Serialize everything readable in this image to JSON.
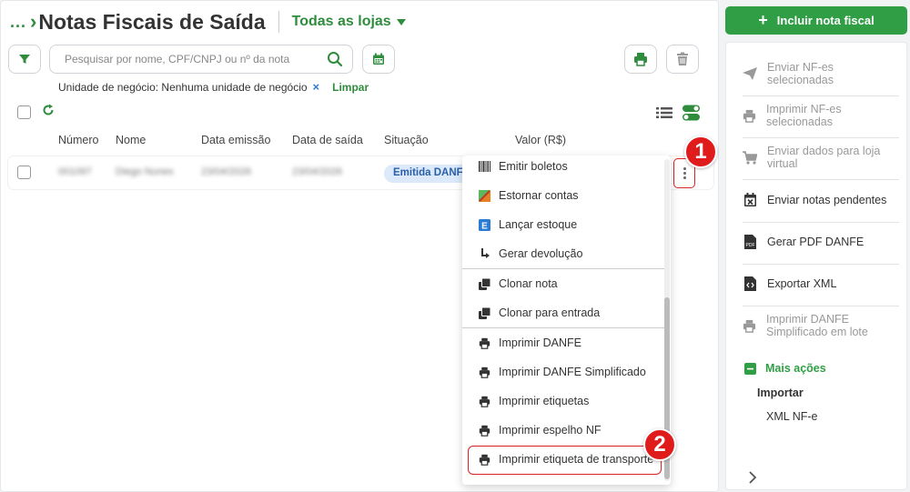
{
  "header": {
    "breadcrumb": "...",
    "title": "Notas Fiscais de Saída",
    "store_selector": "Todas as lojas"
  },
  "toolbar": {
    "search_placeholder": "Pesquisar por nome, CPF/CNPJ ou nº da nota"
  },
  "filters": {
    "business_unit": "Unidade de negócio: Nenhuma unidade de negócio",
    "remove": "×",
    "clear": "Limpar"
  },
  "table": {
    "columns": [
      "Número",
      "Nome",
      "Data emissão",
      "Data de saída",
      "Situação",
      "Valor (R$)"
    ],
    "rows": [
      {
        "numero": "001097",
        "nome": "Diego Nunes",
        "data_emissao": "23/04/2026",
        "data_saida": "23/04/2026",
        "situacao": "Emitida DANFE"
      }
    ]
  },
  "context_menu": {
    "items": [
      "Emitir boletos",
      "Estornar contas",
      "Lançar estoque",
      "Gerar devolução",
      "Clonar nota",
      "Clonar para entrada",
      "Imprimir DANFE",
      "Imprimir DANFE Simplificado",
      "Imprimir etiquetas",
      "Imprimir espelho NF",
      "Imprimir etiqueta de transporte"
    ]
  },
  "badges": {
    "one": "1",
    "two": "2"
  },
  "sidebar": {
    "primary_button": "Incluir nota fiscal",
    "items": [
      "Enviar NF-es selecionadas",
      "Imprimir NF-es selecionadas",
      "Enviar dados para loja virtual",
      "Enviar notas pendentes",
      "Gerar PDF DANFE",
      "Exportar XML",
      "Imprimir DANFE Simplificado em lote"
    ],
    "more_actions": "Mais ações",
    "import_label": "Importar",
    "import_xml": "XML NF-e"
  },
  "colors": {
    "brand_green": "#2f9e44",
    "highlight_red": "#e01b1b",
    "status_blue": "#dbe9fb"
  }
}
